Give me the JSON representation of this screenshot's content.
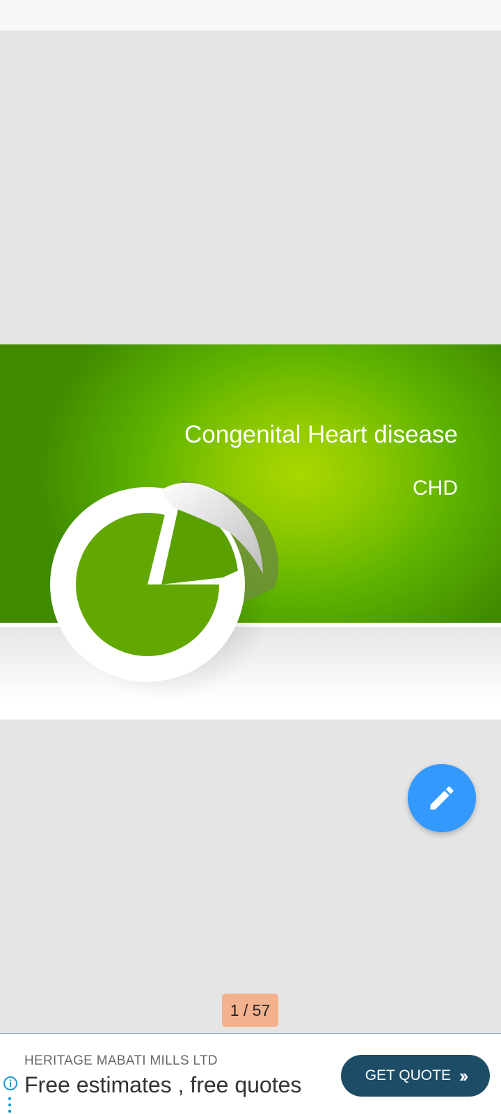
{
  "slide": {
    "title": "Congenital Heart disease",
    "subtitle": "CHD"
  },
  "fab": {
    "icon": "pencil-icon"
  },
  "pager": {
    "current": 1,
    "total": 57,
    "label": "1 / 57"
  },
  "ad": {
    "advertiser": "HERITAGE MABATI MILLS LTD",
    "headline": "Free estimates , free quotes",
    "cta_label": "GET QUOTE",
    "cta_icon": "double-chevron-right-icon",
    "info_icon": "info-icon",
    "menu_icon": "more-vertical-icon"
  },
  "colors": {
    "slide_green": "#5cb200",
    "fab": "#3399ff",
    "pager_bg": "#f3b28e",
    "cta_bg": "#1c4c66"
  }
}
